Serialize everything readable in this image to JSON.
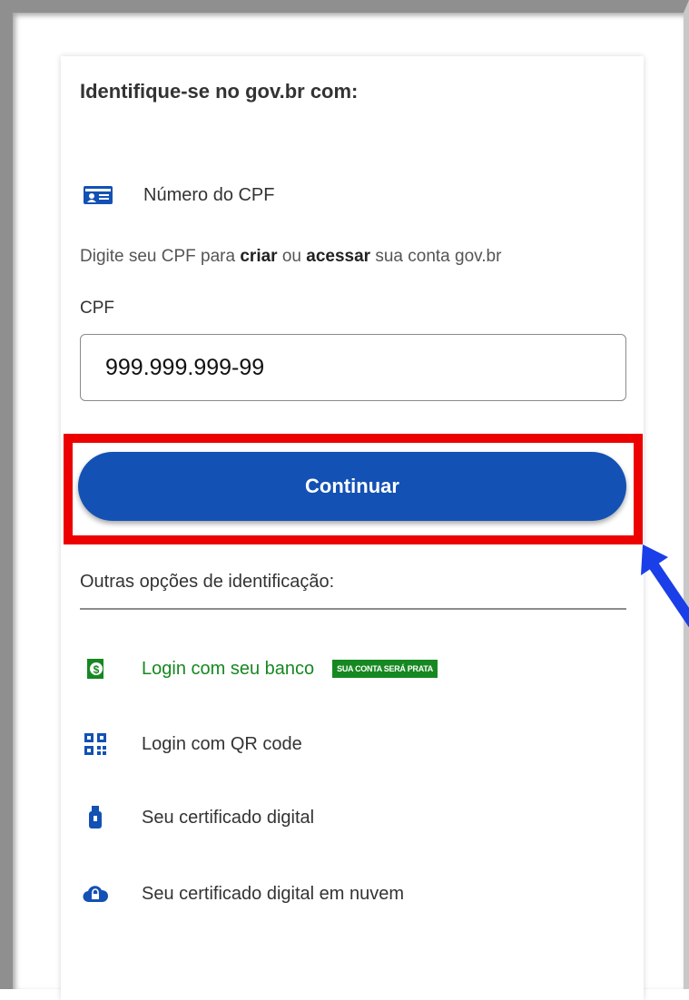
{
  "login": {
    "title": "Identifique-se no gov.br com:",
    "cpf_option": {
      "label": "Número do CPF",
      "icon": "id-card-icon"
    },
    "instructions": {
      "part1": "Digite seu CPF para ",
      "bold1": "criar",
      "part2": " ou ",
      "bold2": "acessar",
      "part3": " sua conta gov.br"
    },
    "cpf_field": {
      "label": "CPF",
      "value": "999.999.999-99"
    },
    "continue_label": "Continuar",
    "other_options": {
      "title": "Outras opções de identificação:",
      "items": [
        {
          "label": "Login com seu banco",
          "icon": "bank-money-icon",
          "badge": "SUA CONTA SERÁ PRATA"
        },
        {
          "label": "Login com QR code",
          "icon": "qr-code-icon"
        },
        {
          "label": "Seu certificado digital",
          "icon": "usb-token-icon"
        },
        {
          "label": "Seu certificado digital em nuvem",
          "icon": "cloud-lock-icon"
        }
      ]
    }
  },
  "colors": {
    "primary": "#1351b4",
    "highlight": "#ec0000",
    "bank_green": "#168821",
    "arrow_blue": "#1a3ee8"
  }
}
